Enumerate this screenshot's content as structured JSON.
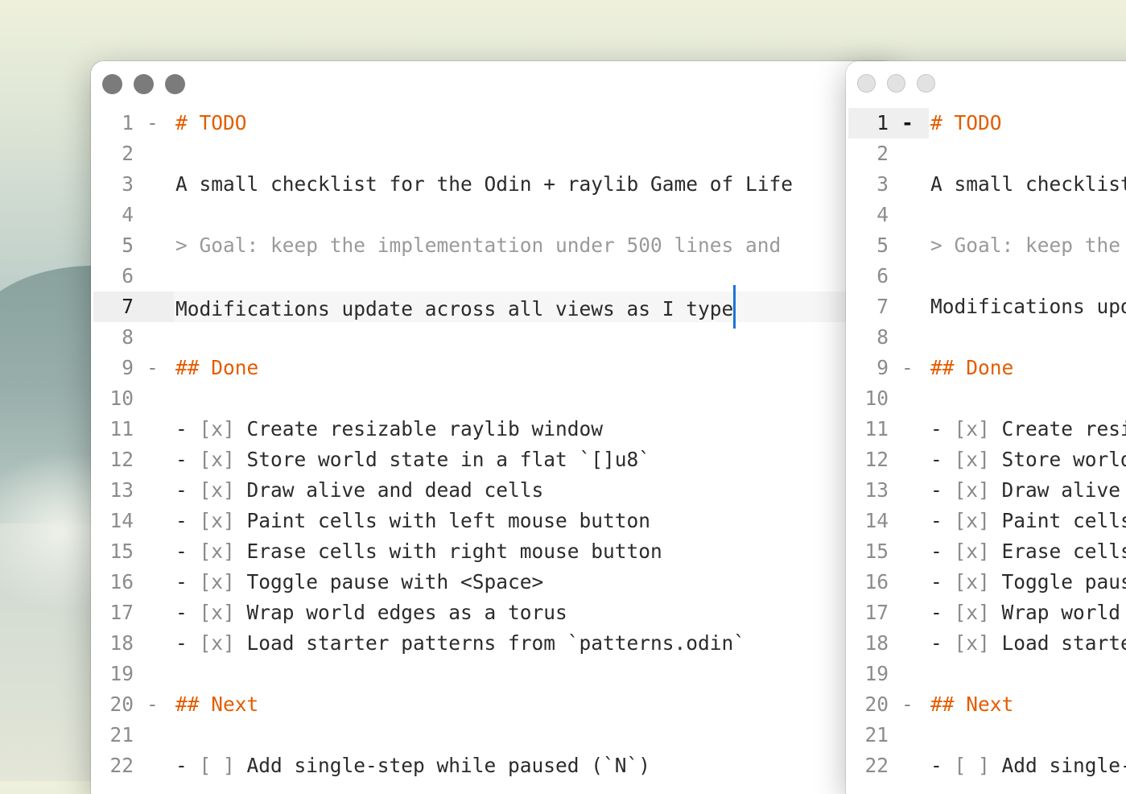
{
  "lines": [
    {
      "n": "1",
      "text": "# TODO",
      "kind": "heading",
      "fold": true
    },
    {
      "n": "2",
      "text": "",
      "kind": "plain"
    },
    {
      "n": "3",
      "text": "A small checklist for the Odin + raylib Game of Life",
      "kind": "plain"
    },
    {
      "n": "4",
      "text": "",
      "kind": "plain"
    },
    {
      "n": "5",
      "text": "> Goal: keep the implementation under 500 lines and",
      "kind": "quote"
    },
    {
      "n": "6",
      "text": "",
      "kind": "plain"
    },
    {
      "n": "7",
      "text": "Modifications update across all views as I type",
      "kind": "plain"
    },
    {
      "n": "8",
      "text": "",
      "kind": "plain"
    },
    {
      "n": "9",
      "text": "## Done",
      "kind": "heading",
      "fold": true
    },
    {
      "n": "10",
      "text": "",
      "kind": "plain"
    },
    {
      "n": "11",
      "prefix": "- ",
      "mark": "[x]",
      "text": " Create resizable raylib window",
      "kind": "task"
    },
    {
      "n": "12",
      "prefix": "- ",
      "mark": "[x]",
      "text": " Store world state in a flat `[]u8`",
      "kind": "task"
    },
    {
      "n": "13",
      "prefix": "- ",
      "mark": "[x]",
      "text": " Draw alive and dead cells",
      "kind": "task"
    },
    {
      "n": "14",
      "prefix": "- ",
      "mark": "[x]",
      "text": " Paint cells with left mouse button",
      "kind": "task"
    },
    {
      "n": "15",
      "prefix": "- ",
      "mark": "[x]",
      "text": " Erase cells with right mouse button",
      "kind": "task"
    },
    {
      "n": "16",
      "prefix": "- ",
      "mark": "[x]",
      "text": " Toggle pause with <Space>",
      "kind": "task"
    },
    {
      "n": "17",
      "prefix": "- ",
      "mark": "[x]",
      "text": " Wrap world edges as a torus",
      "kind": "task"
    },
    {
      "n": "18",
      "prefix": "- ",
      "mark": "[x]",
      "text": " Load starter patterns from `patterns.odin`",
      "kind": "task"
    },
    {
      "n": "19",
      "text": "",
      "kind": "plain"
    },
    {
      "n": "20",
      "text": "## Next",
      "kind": "heading",
      "fold": true
    },
    {
      "n": "21",
      "text": "",
      "kind": "plain"
    },
    {
      "n": "22",
      "prefix": "- ",
      "mark": "[ ]",
      "text": " Add single-step while paused (`N`)",
      "kind": "task"
    }
  ],
  "fold_marker": "-",
  "windows": {
    "left": {
      "current_line": "7"
    },
    "right": {
      "current_line": "1"
    }
  }
}
